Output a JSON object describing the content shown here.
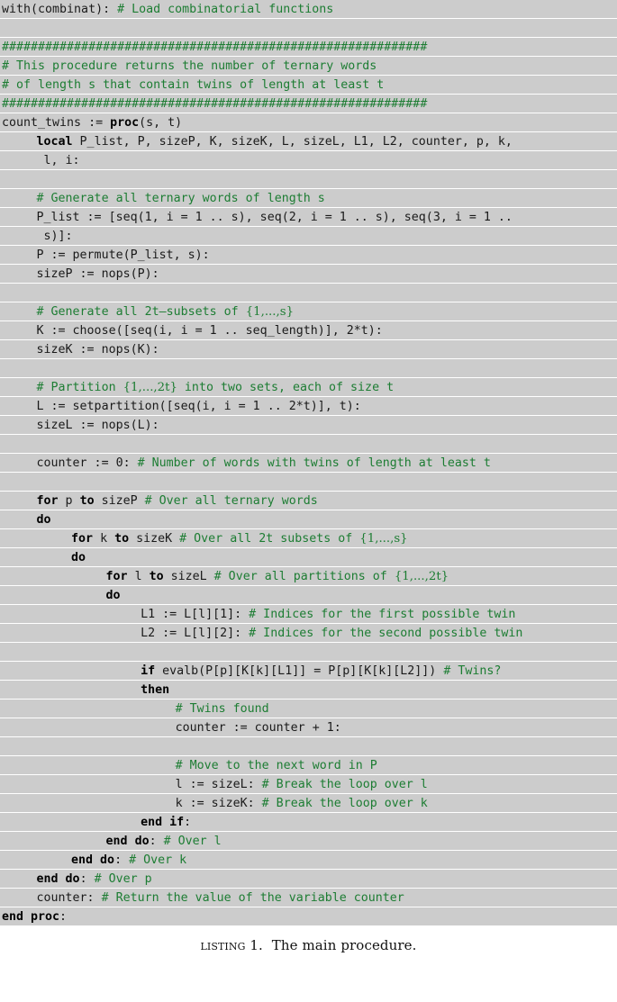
{
  "listing": {
    "caption_label": "Listing",
    "caption_number": "1.",
    "caption_text": "The main procedure.",
    "caption_full": "Listing 1. The main procedure.",
    "language": "Maple",
    "colors": {
      "background": "#cccccc",
      "separator": "#ffffff",
      "code_text": "#1a1a1a",
      "comment": "#1d7d33",
      "keyword": "#000000",
      "page": "#ffffff"
    },
    "lines": [
      {
        "n": 1,
        "indent": 0,
        "segments": [
          {
            "t": "code",
            "v": "with(combinat): "
          },
          {
            "t": "comment",
            "v": "# Load combinatorial functions"
          }
        ]
      },
      {
        "n": 2,
        "indent": 0,
        "segments": []
      },
      {
        "n": 3,
        "indent": 0,
        "segments": [
          {
            "t": "comment",
            "v": "###########################################################"
          }
        ]
      },
      {
        "n": 4,
        "indent": 0,
        "segments": [
          {
            "t": "comment",
            "v": "# This procedure returns the number of ternary words"
          }
        ]
      },
      {
        "n": 5,
        "indent": 0,
        "segments": [
          {
            "t": "comment",
            "v": "# of length s that contain twins of length at least t"
          }
        ]
      },
      {
        "n": 6,
        "indent": 0,
        "segments": [
          {
            "t": "comment",
            "v": "###########################################################"
          }
        ]
      },
      {
        "n": 7,
        "indent": 0,
        "segments": [
          {
            "t": "code",
            "v": "count_twins := "
          },
          {
            "t": "keyword",
            "v": "proc"
          },
          {
            "t": "code",
            "v": "(s, t)"
          }
        ]
      },
      {
        "n": 8,
        "indent": 4,
        "segments": [
          {
            "t": "keyword",
            "v": "local"
          },
          {
            "t": "code",
            "v": " P_list, P, sizeP, K, sizeK, L, sizeL, L1, L2, counter, p, k,"
          }
        ]
      },
      {
        "n": 9,
        "indent": 4,
        "segments": [
          {
            "t": "code",
            "v": " l, i:"
          }
        ]
      },
      {
        "n": 10,
        "indent": 0,
        "segments": []
      },
      {
        "n": 11,
        "indent": 4,
        "segments": [
          {
            "t": "comment",
            "v": "# Generate all ternary words of length s"
          }
        ]
      },
      {
        "n": 12,
        "indent": 4,
        "segments": [
          {
            "t": "code",
            "v": "P_list := [seq(1, i = 1 .. s), seq(2, i = 1 .. s), seq(3, i = 1 .."
          }
        ]
      },
      {
        "n": 13,
        "indent": 4,
        "segments": [
          {
            "t": "code",
            "v": " s)]:"
          }
        ]
      },
      {
        "n": 14,
        "indent": 4,
        "segments": [
          {
            "t": "code",
            "v": "P := permute(P_list, s):"
          }
        ]
      },
      {
        "n": 15,
        "indent": 4,
        "segments": [
          {
            "t": "code",
            "v": "sizeP := nops(P):"
          }
        ]
      },
      {
        "n": 16,
        "indent": 0,
        "segments": []
      },
      {
        "n": 17,
        "indent": 4,
        "segments": [
          {
            "t": "comment",
            "v": "# Generate all 2t–subsets of "
          },
          {
            "t": "comment-math",
            "v": "{1,...,s}"
          }
        ]
      },
      {
        "n": 18,
        "indent": 4,
        "segments": [
          {
            "t": "code",
            "v": "K := choose([seq(i, i = 1 .. seq_length)], 2*t):"
          }
        ]
      },
      {
        "n": 19,
        "indent": 4,
        "segments": [
          {
            "t": "code",
            "v": "sizeK := nops(K):"
          }
        ]
      },
      {
        "n": 20,
        "indent": 0,
        "segments": []
      },
      {
        "n": 21,
        "indent": 4,
        "segments": [
          {
            "t": "comment",
            "v": "# Partition "
          },
          {
            "t": "comment-math",
            "v": "{1,...,2t}"
          },
          {
            "t": "comment",
            "v": " into two sets, each of size t"
          }
        ]
      },
      {
        "n": 22,
        "indent": 4,
        "segments": [
          {
            "t": "code",
            "v": "L := setpartition([seq(i, i = 1 .. 2*t)], t):"
          }
        ]
      },
      {
        "n": 23,
        "indent": 4,
        "segments": [
          {
            "t": "code",
            "v": "sizeL := nops(L):"
          }
        ]
      },
      {
        "n": 24,
        "indent": 0,
        "segments": []
      },
      {
        "n": 25,
        "indent": 4,
        "segments": [
          {
            "t": "code",
            "v": "counter := 0: "
          },
          {
            "t": "comment",
            "v": "# Number of words with twins of length at least t"
          }
        ]
      },
      {
        "n": 26,
        "indent": 0,
        "segments": []
      },
      {
        "n": 27,
        "indent": 4,
        "segments": [
          {
            "t": "keyword",
            "v": "for"
          },
          {
            "t": "code",
            "v": " p "
          },
          {
            "t": "keyword",
            "v": "to"
          },
          {
            "t": "code",
            "v": " sizeP "
          },
          {
            "t": "comment",
            "v": "# Over all ternary words"
          }
        ]
      },
      {
        "n": 28,
        "indent": 4,
        "segments": [
          {
            "t": "keyword",
            "v": "do"
          }
        ]
      },
      {
        "n": 29,
        "indent": 8,
        "segments": [
          {
            "t": "keyword",
            "v": "for"
          },
          {
            "t": "code",
            "v": " k "
          },
          {
            "t": "keyword",
            "v": "to"
          },
          {
            "t": "code",
            "v": " sizeK "
          },
          {
            "t": "comment",
            "v": "# Over all 2t subsets of "
          },
          {
            "t": "comment-math",
            "v": "{1,...,s}"
          }
        ]
      },
      {
        "n": 30,
        "indent": 8,
        "segments": [
          {
            "t": "keyword",
            "v": "do"
          }
        ]
      },
      {
        "n": 31,
        "indent": 12,
        "segments": [
          {
            "t": "keyword",
            "v": "for"
          },
          {
            "t": "code",
            "v": " l "
          },
          {
            "t": "keyword",
            "v": "to"
          },
          {
            "t": "code",
            "v": " sizeL "
          },
          {
            "t": "comment",
            "v": "# Over all partitions of "
          },
          {
            "t": "comment-math",
            "v": "{1,...,2t}"
          }
        ]
      },
      {
        "n": 32,
        "indent": 12,
        "segments": [
          {
            "t": "keyword",
            "v": "do"
          }
        ]
      },
      {
        "n": 33,
        "indent": 16,
        "segments": [
          {
            "t": "code",
            "v": "L1 := L[l][1]: "
          },
          {
            "t": "comment",
            "v": "# Indices for the first possible twin"
          }
        ]
      },
      {
        "n": 34,
        "indent": 16,
        "segments": [
          {
            "t": "code",
            "v": "L2 := L[l][2]: "
          },
          {
            "t": "comment",
            "v": "# Indices for the second possible twin"
          }
        ]
      },
      {
        "n": 35,
        "indent": 0,
        "segments": []
      },
      {
        "n": 36,
        "indent": 16,
        "segments": [
          {
            "t": "keyword",
            "v": "if"
          },
          {
            "t": "code",
            "v": " evalb(P[p][K[k][L1]] = P[p][K[k][L2]]) "
          },
          {
            "t": "comment",
            "v": "# Twins?"
          }
        ]
      },
      {
        "n": 37,
        "indent": 16,
        "segments": [
          {
            "t": "keyword",
            "v": "then"
          }
        ]
      },
      {
        "n": 38,
        "indent": 20,
        "segments": [
          {
            "t": "comment",
            "v": "# Twins found"
          }
        ]
      },
      {
        "n": 39,
        "indent": 20,
        "segments": [
          {
            "t": "code",
            "v": "counter := counter + 1:"
          }
        ]
      },
      {
        "n": 40,
        "indent": 0,
        "segments": []
      },
      {
        "n": 41,
        "indent": 20,
        "segments": [
          {
            "t": "comment",
            "v": "# Move to the next word in P"
          }
        ]
      },
      {
        "n": 42,
        "indent": 20,
        "segments": [
          {
            "t": "code",
            "v": "l := sizeL: "
          },
          {
            "t": "comment",
            "v": "# Break the loop over l"
          }
        ]
      },
      {
        "n": 43,
        "indent": 20,
        "segments": [
          {
            "t": "code",
            "v": "k := sizeK: "
          },
          {
            "t": "comment",
            "v": "# Break the loop over k"
          }
        ]
      },
      {
        "n": 44,
        "indent": 16,
        "segments": [
          {
            "t": "keyword",
            "v": "end if"
          },
          {
            "t": "code",
            "v": ":"
          }
        ]
      },
      {
        "n": 45,
        "indent": 12,
        "segments": [
          {
            "t": "keyword",
            "v": "end do"
          },
          {
            "t": "code",
            "v": ": "
          },
          {
            "t": "comment",
            "v": "# Over l"
          }
        ]
      },
      {
        "n": 46,
        "indent": 8,
        "segments": [
          {
            "t": "keyword",
            "v": "end do"
          },
          {
            "t": "code",
            "v": ": "
          },
          {
            "t": "comment",
            "v": "# Over k"
          }
        ]
      },
      {
        "n": 47,
        "indent": 4,
        "segments": [
          {
            "t": "keyword",
            "v": "end do"
          },
          {
            "t": "code",
            "v": ": "
          },
          {
            "t": "comment",
            "v": "# Over p"
          }
        ]
      },
      {
        "n": 48,
        "indent": 4,
        "segments": [
          {
            "t": "code",
            "v": "counter: "
          },
          {
            "t": "comment",
            "v": "# Return the value of the variable counter"
          }
        ]
      },
      {
        "n": 49,
        "indent": 0,
        "segments": [
          {
            "t": "keyword",
            "v": "end proc"
          },
          {
            "t": "code",
            "v": ":"
          }
        ]
      }
    ]
  }
}
